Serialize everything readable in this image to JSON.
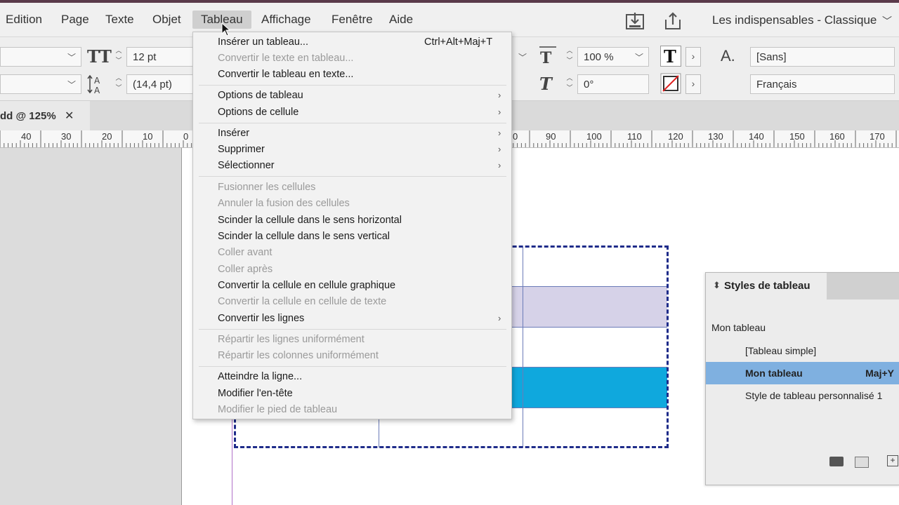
{
  "menubar": {
    "items": [
      "Edition",
      "Page",
      "Texte",
      "Objet",
      "Tableau",
      "Affichage",
      "Fenêtre",
      "Aide"
    ],
    "active": "Tableau",
    "workspace": "Les indispensables - Classique"
  },
  "control_panel": {
    "font_size": "12 pt",
    "leading": "(14,4 pt)",
    "scale": "100 %",
    "skew": "0°",
    "character_style": "[Sans]",
    "language": "Français"
  },
  "document_tab": {
    "label": "dd @ 125%",
    "close": "✕"
  },
  "ruler": {
    "ticks": [
      "40",
      "30",
      "20",
      "10",
      "0",
      "0",
      "90",
      "100",
      "110",
      "120",
      "130",
      "140",
      "150",
      "160",
      "170"
    ]
  },
  "dropdown": {
    "items": [
      {
        "label": "Insérer un tableau...",
        "shortcut": "Ctrl+Alt+Maj+T",
        "enabled": true
      },
      {
        "label": "Convertir le texte en tableau...",
        "enabled": false
      },
      {
        "label": "Convertir le tableau en texte...",
        "enabled": true
      },
      {
        "label": "Options de tableau",
        "enabled": true,
        "submenu": true
      },
      {
        "label": "Options de cellule",
        "enabled": true,
        "submenu": true
      },
      {
        "label": "Insérer",
        "enabled": true,
        "submenu": true
      },
      {
        "label": "Supprimer",
        "enabled": true,
        "submenu": true
      },
      {
        "label": "Sélectionner",
        "enabled": true,
        "submenu": true
      },
      {
        "label": "Fusionner les cellules",
        "enabled": false
      },
      {
        "label": "Annuler la fusion des cellules",
        "enabled": false
      },
      {
        "label": "Scinder la cellule dans le sens horizontal",
        "enabled": true
      },
      {
        "label": "Scinder la cellule dans le sens vertical",
        "enabled": true
      },
      {
        "label": "Coller avant",
        "enabled": false
      },
      {
        "label": "Coller après",
        "enabled": false
      },
      {
        "label": "Convertir la cellule en cellule graphique",
        "enabled": true
      },
      {
        "label": "Convertir la cellule en cellule de texte",
        "enabled": false
      },
      {
        "label": "Convertir les lignes",
        "enabled": true,
        "submenu": true
      },
      {
        "label": "Répartir les lignes uniformément",
        "enabled": false
      },
      {
        "label": "Répartir les colonnes uniformément",
        "enabled": false
      },
      {
        "label": "Atteindre la ligne...",
        "enabled": true
      },
      {
        "label": "Modifier l'en-tête",
        "enabled": true
      },
      {
        "label": "Modifier le pied de tableau",
        "enabled": false
      }
    ],
    "submenu_arrow": "›"
  },
  "styles_panel": {
    "title": "Styles de tableau",
    "current": "Mon tableau",
    "styles": [
      {
        "label": "[Tableau simple]",
        "shortcut": ""
      },
      {
        "label": "Mon tableau",
        "shortcut": "Maj+Y",
        "selected": true
      },
      {
        "label": "Style de tableau personnalisé 1",
        "shortcut": ""
      }
    ]
  },
  "colors": {
    "table_border": "#1f2c8a",
    "row_purple": "#d6d2e8",
    "row_blue": "#0fa8dd",
    "selected_style": "#7fb0e0"
  }
}
